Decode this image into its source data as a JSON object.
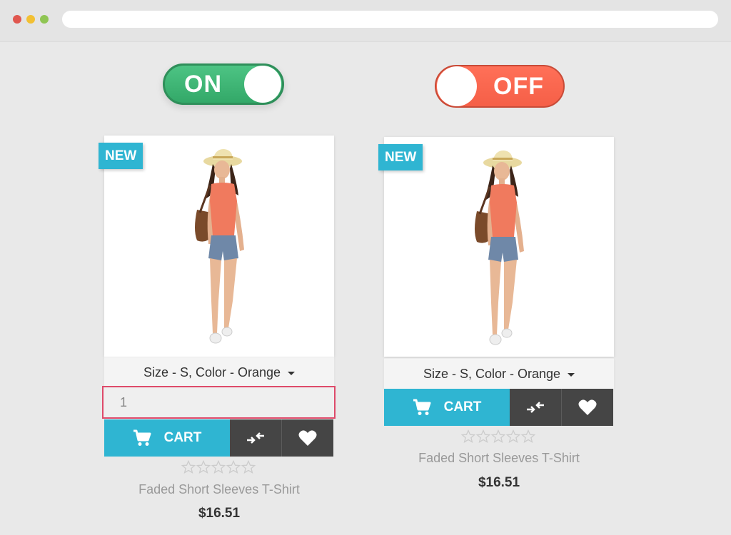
{
  "toggles": {
    "on_label": "ON",
    "off_label": "OFF"
  },
  "products": [
    {
      "badge": "NEW",
      "variant": "Size - S, Color - Orange",
      "quantity": "1",
      "cart_label": "CART",
      "name": "Faded Short Sleeves T-Shirt",
      "price": "$16.51",
      "rating": 0
    },
    {
      "badge": "NEW",
      "variant": "Size - S, Color - Orange",
      "cart_label": "CART",
      "name": "Faded Short Sleeves T-Shirt",
      "price": "$16.51",
      "rating": 0
    }
  ],
  "colors": {
    "accent": "#2fb5d2",
    "toggle_on": "#3bb574",
    "toggle_off": "#f86650",
    "dark_button": "#454545",
    "qty_border": "#de4a6a"
  },
  "icons": [
    "cart-icon",
    "compare-icon",
    "heart-icon",
    "star-icon",
    "caret-down-icon"
  ]
}
